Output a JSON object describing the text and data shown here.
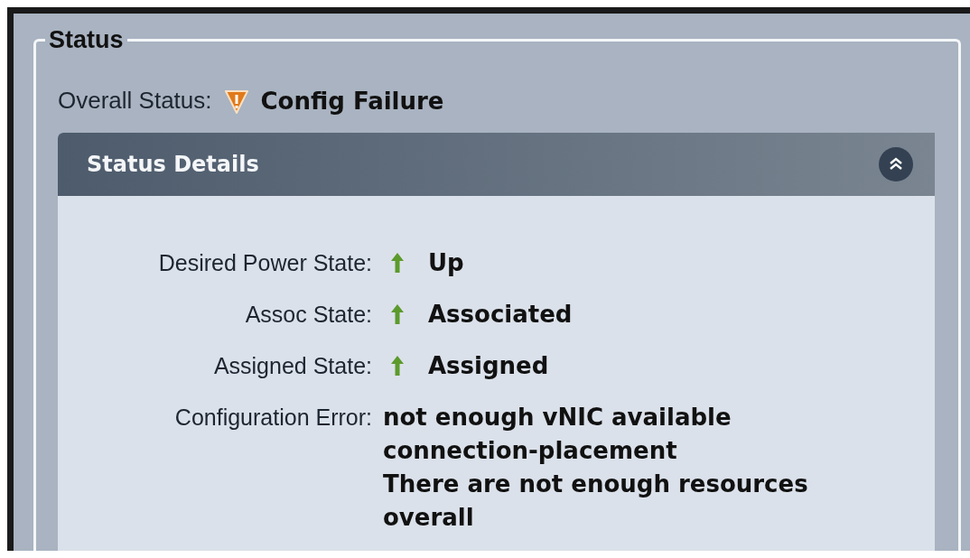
{
  "group": {
    "title": "Status"
  },
  "overall": {
    "label": "Overall Status:",
    "value": "Config Failure",
    "kind": "failure"
  },
  "details": {
    "title": "Status Details",
    "expanded": true,
    "rows": [
      {
        "label": "Desired Power State:",
        "value": "Up",
        "kind": "up"
      },
      {
        "label": "Assoc State:",
        "value": "Associated",
        "kind": "up"
      },
      {
        "label": "Assigned State:",
        "value": "Assigned",
        "kind": "up"
      }
    ],
    "error": {
      "label": "Configuration Error:",
      "lines": [
        "not enough vNIC available",
        "connection-placement",
        "There are not enough resources",
        "overall"
      ]
    }
  }
}
